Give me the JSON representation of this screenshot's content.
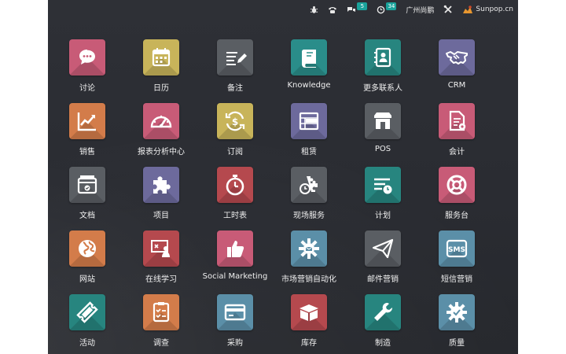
{
  "topbar": {
    "bug_icon": "bug-icon",
    "phone_icon": "phone-icon",
    "messages_count": "5",
    "activities_count": "34",
    "company": "广州尚鹏",
    "settings_icon": "tools-icon",
    "user": "Sunpop.cn"
  },
  "apps": [
    {
      "label": "讨论",
      "icon": "chat-icon",
      "color": "#c85b77"
    },
    {
      "label": "日历",
      "icon": "calendar-icon",
      "color": "#c8b45a"
    },
    {
      "label": "备注",
      "icon": "note-icon",
      "color": "#5a5e63"
    },
    {
      "label": "Knowledge",
      "icon": "book-icon",
      "color": "#2a8d8a"
    },
    {
      "label": "更多联系人",
      "icon": "contacts-icon",
      "color": "#27857f"
    },
    {
      "label": "CRM",
      "icon": "handshake-icon",
      "color": "#6d6a9c"
    },
    {
      "label": "销售",
      "icon": "sales-chart-icon",
      "color": "#d37c4a"
    },
    {
      "label": "报表分析中心",
      "icon": "gauge-icon",
      "color": "#c85b77"
    },
    {
      "label": "订阅",
      "icon": "subscription-icon",
      "color": "#c8b45a"
    },
    {
      "label": "租赁",
      "icon": "rental-icon",
      "color": "#6d6a9c"
    },
    {
      "label": "POS",
      "icon": "shop-icon",
      "color": "#5a5e63"
    },
    {
      "label": "会计",
      "icon": "invoice-icon",
      "color": "#c85b77"
    },
    {
      "label": "文档",
      "icon": "inbox-icon",
      "color": "#5a5e63"
    },
    {
      "label": "项目",
      "icon": "puzzle-icon",
      "color": "#6d6a9c"
    },
    {
      "label": "工时表",
      "icon": "stopwatch-icon",
      "color": "#b5494e"
    },
    {
      "label": "现场服务",
      "icon": "field-service-icon",
      "color": "#5a5e63"
    },
    {
      "label": "计划",
      "icon": "planning-icon",
      "color": "#27857f"
    },
    {
      "label": "服务台",
      "icon": "lifebuoy-icon",
      "color": "#c85b77"
    },
    {
      "label": "网站",
      "icon": "globe-icon",
      "color": "#d37c4a"
    },
    {
      "label": "在线学习",
      "icon": "elearning-icon",
      "color": "#b5494e"
    },
    {
      "label": "Social Marketing",
      "icon": "thumbs-up-icon",
      "color": "#c85b77"
    },
    {
      "label": "市场营销自动化",
      "icon": "gear-icon",
      "color": "#5b8fa8"
    },
    {
      "label": "邮件营销",
      "icon": "paper-plane-icon",
      "color": "#5a5e63"
    },
    {
      "label": "短信营销",
      "icon": "sms-icon",
      "color": "#5b8fa8"
    },
    {
      "label": "活动",
      "icon": "ticket-icon",
      "color": "#27857f"
    },
    {
      "label": "调查",
      "icon": "survey-icon",
      "color": "#d37c4a"
    },
    {
      "label": "采购",
      "icon": "credit-card-icon",
      "color": "#5b8fa8"
    },
    {
      "label": "库存",
      "icon": "box-icon",
      "color": "#b5494e"
    },
    {
      "label": "制造",
      "icon": "wrench-icon",
      "color": "#27857f"
    },
    {
      "label": "质量",
      "icon": "quality-icon",
      "color": "#5b8fa8"
    }
  ]
}
